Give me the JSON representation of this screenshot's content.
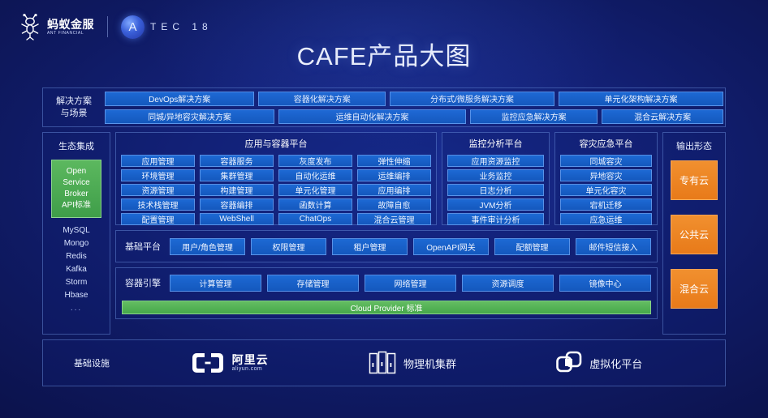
{
  "brand": {
    "ant_cn": "蚂蚁金服",
    "ant_en": "ANT FINANCIAL",
    "atec_letter": "A",
    "atec_word": "TEC 18"
  },
  "title": "CAFE产品大图",
  "solutions": {
    "label_line1": "解决方案",
    "label_line2": "与场景",
    "row1": [
      "DevOps解决方案",
      "容器化解决方案",
      "分布式/微服务解决方案",
      "单元化架构解决方案"
    ],
    "row2": [
      "同城/异地容灾解决方案",
      "运维自动化解决方案",
      "监控应急解决方案",
      "混合云解决方案"
    ]
  },
  "ecosystem": {
    "title": "生态集成",
    "green_box": [
      "Open",
      "Service",
      "Broker",
      "API标准"
    ],
    "items": [
      "MySQL",
      "Mongo",
      "Redis",
      "Kafka",
      "Storm",
      "Hbase",
      "..."
    ]
  },
  "app_platform": {
    "title": "应用与容器平台",
    "items": [
      "应用管理",
      "容器服务",
      "灰度发布",
      "弹性伸缩",
      "环境管理",
      "集群管理",
      "自动化运维",
      "运维编排",
      "资源管理",
      "构建管理",
      "单元化管理",
      "应用编排",
      "技术栈管理",
      "容器编排",
      "函数计算",
      "故障自愈",
      "配置管理",
      "WebShell",
      "ChatOps",
      "混合云管理"
    ]
  },
  "monitor_platform": {
    "title": "监控分析平台",
    "items": [
      "应用资源监控",
      "业务监控",
      "日志分析",
      "JVM分析",
      "事件审计分析"
    ]
  },
  "dr_platform": {
    "title": "容灾应急平台",
    "items": [
      "同城容灾",
      "异地容灾",
      "单元化容灾",
      "宕机迁移",
      "应急运维"
    ]
  },
  "base_platform": {
    "label": "基础平台",
    "items": [
      "用户/角色管理",
      "权限管理",
      "租户管理",
      "OpenAPI网关",
      "配额管理",
      "邮件短信接入"
    ]
  },
  "container_engine": {
    "label": "容器引擎",
    "items": [
      "计算管理",
      "存储管理",
      "网络管理",
      "资源调度",
      "镜像中心"
    ],
    "cloud_provider_bar": "Cloud Provider 标准"
  },
  "output": {
    "title": "输出形态",
    "items": [
      "专有云",
      "公共云",
      "混合云"
    ]
  },
  "infrastructure": {
    "label": "基础设施",
    "aliyun_cn": "阿里云",
    "aliyun_en": "aliyun.com",
    "physical": "物理机集群",
    "virtual": "虚拟化平台"
  },
  "colors": {
    "chip_blue": "#1458bd",
    "green": "#46a84b",
    "orange": "#e87a19",
    "bg_deep": "#0b1148"
  }
}
